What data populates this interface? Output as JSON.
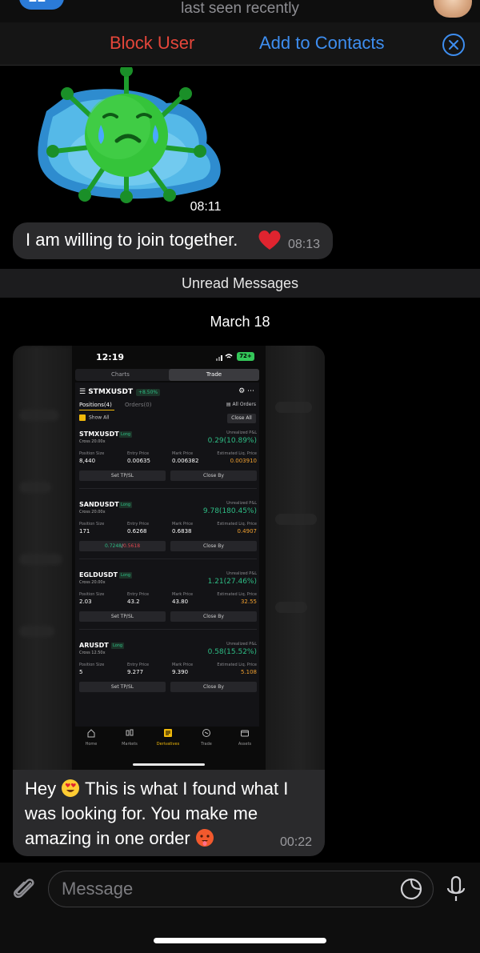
{
  "header": {
    "back_count": "22",
    "status": "last seen recently"
  },
  "action_bar": {
    "block_label": "Block User",
    "add_label": "Add to Contacts"
  },
  "messages": {
    "sticker_time": "08:11",
    "msg1_text": "I am willing to join together.",
    "msg1_time": "08:13",
    "unread_label": "Unread Messages",
    "date_label": "March 18",
    "caption_part1": "Hey",
    "caption_part2": "This is what I found what I was looking for.  You make me amazing in one order",
    "caption_time": "00:22"
  },
  "screenshot": {
    "time": "12:19",
    "battery": "72+",
    "tabs": [
      "Charts",
      "Trade"
    ],
    "symbol": "STMXUSDT",
    "symbol_change": "+8.50%",
    "positions_tab": "Positions(4)",
    "orders_tab": "Orders(0)",
    "all_orders": "All Orders",
    "show_all": "Show All",
    "close_all": "Close All",
    "labels": {
      "unrealized": "Unrealized P&L",
      "position_size": "Position Size",
      "entry_price": "Entry Price",
      "mark_price": "Mark Price",
      "liq_price": "Estimated Liq. Price",
      "long": "Long"
    },
    "positions": [
      {
        "name": "STMXUSDT",
        "cross": "Cross 20.00x",
        "pnl": "0.29(10.89%)",
        "size": "8,440",
        "entry": "0.00635",
        "mark": "0.006382",
        "liq": "0.003910",
        "btn1": "Set TP/SL",
        "btn2": "Close By"
      },
      {
        "name": "SANDUSDT",
        "cross": "Cross 20.00x",
        "pnl": "9.78(180.45%)",
        "size": "171",
        "entry": "0.6268",
        "mark": "0.6838",
        "liq": "0.4907",
        "btn1_g": "0.7248",
        "btn1_r": "0.5618",
        "btn2": "Close By"
      },
      {
        "name": "EGLDUSDT",
        "cross": "Cross 20.00x",
        "pnl": "1.21(27.46%)",
        "size": "2.03",
        "entry": "43.2",
        "mark": "43.80",
        "liq": "32.55",
        "btn1": "Set TP/SL",
        "btn2": "Close By"
      },
      {
        "name": "ARUSDT",
        "cross": "Cross 12.50x",
        "pnl": "0.58(15.52%)",
        "size": "5",
        "entry": "9.277",
        "mark": "9.390",
        "liq": "5.108",
        "btn1": "Set TP/SL",
        "btn2": "Close By"
      }
    ],
    "nav": [
      "Home",
      "Markets",
      "Derivatives",
      "Trade",
      "Assets"
    ]
  },
  "input": {
    "placeholder": "Message"
  },
  "colors": {
    "accent_blue": "#3e8ef0",
    "danger_red": "#e5463a",
    "profit_green": "#2ebd85",
    "binance_yellow": "#f0b90b"
  },
  "icons": [
    "back-icon",
    "close-icon",
    "heart-icon",
    "heart-eyes-emoji",
    "hot-face-emoji",
    "attach-icon",
    "sticker-icon",
    "mic-icon"
  ]
}
